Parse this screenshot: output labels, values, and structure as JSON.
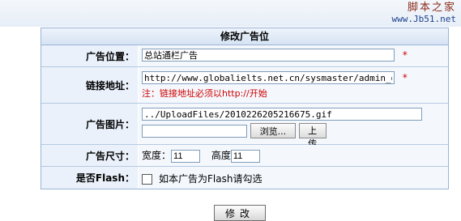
{
  "watermark": {
    "title": "脚本之家",
    "url": "www.Jb51.net"
  },
  "panel": {
    "title": "修改广告位"
  },
  "fields": {
    "position": {
      "label": "广告位置：",
      "value": "总站通栏广告",
      "required_mark": "*"
    },
    "link": {
      "label": "链接地址：",
      "value": "http://www.globalielts.net.cn/sysmaster/admin_datab",
      "required_mark": "*",
      "note": "注：链接地址必须以http://开始"
    },
    "image": {
      "label": "广告图片：",
      "path_value": "../UploadFiles/2010226205216675.gif",
      "browse_label": "浏览...",
      "upload_label": "上传"
    },
    "size": {
      "label": "广告尺寸：",
      "width_label": "宽度：",
      "width_value": "11",
      "height_label": "高度",
      "height_value": "11"
    },
    "flash": {
      "label": "是否Flash：",
      "checkbox_label": "如本广告为Flash请勾选",
      "checked": false
    }
  },
  "actions": {
    "submit_label": "修改"
  }
}
